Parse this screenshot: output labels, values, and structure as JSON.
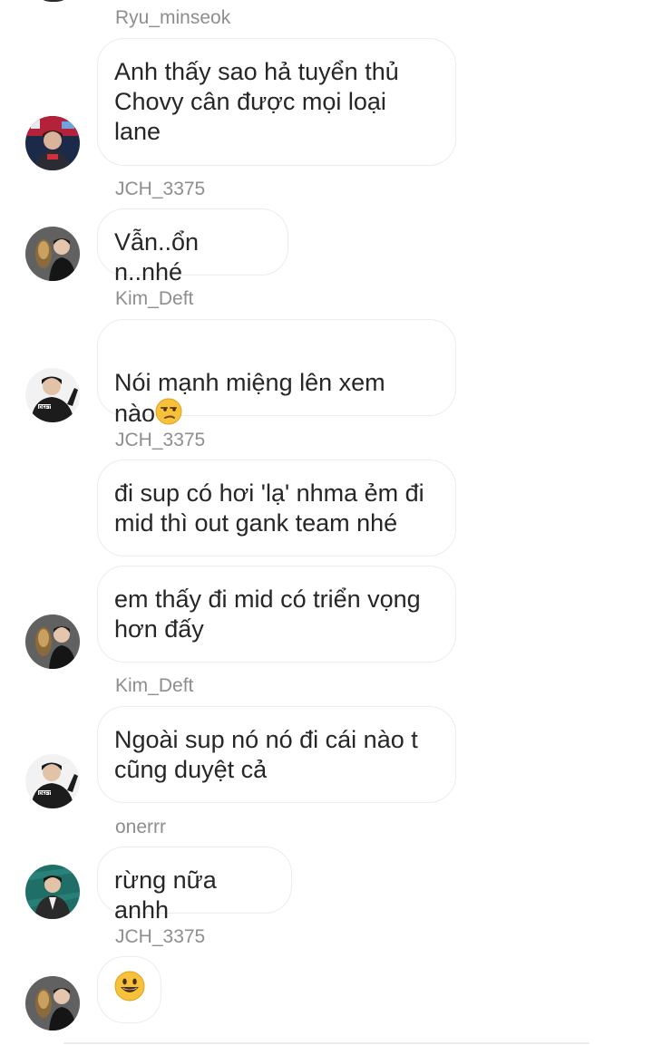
{
  "messages": [
    {
      "sender": "Ryu_minseok",
      "lines": [
        "Anh thấy sao hả tuyển thủ",
        "Chovy cân được mọi loại",
        "lane"
      ]
    },
    {
      "sender": "JCH_3375",
      "lines": [
        "Vẫn..ổn n..nhé"
      ]
    },
    {
      "sender": "Kim_Deft",
      "lines": [
        "Nói mạnh miệng lên xem",
        "nào"
      ],
      "emoji": "unamused-face"
    },
    {
      "sender": "JCH_3375",
      "lines": [
        "đi sup có hơi 'lạ' nhma ẻm đi",
        "mid thì out gank team nhé"
      ]
    },
    {
      "sender": "",
      "lines": [
        "em thấy đi mid có triển vọng",
        "hơn đấy"
      ]
    },
    {
      "sender": "Kim_Deft",
      "lines": [
        "Ngoài sup nó nó đi cái nào t",
        "cũng duyệt cả"
      ]
    },
    {
      "sender": "onerrr",
      "lines": [
        "rừng nữa anhh"
      ]
    },
    {
      "sender": "JCH_3375",
      "lines": [],
      "emoji": "grinning-face"
    }
  ],
  "names": {
    "n1": "Ryu_minseok",
    "n2": "JCH_3375",
    "n3": "Kim_Deft",
    "n4": "JCH_3375",
    "n5": "Kim_Deft",
    "n6": "onerrr",
    "n7": "JCH_3375"
  },
  "bubbles": {
    "b1": "Anh thấy sao hả tuyển thủ\nChovy cân được mọi loại\nlane",
    "b2": "Vẫn..ổn n..nhé",
    "b3_text": "Nói mạnh miệng lên xem\nnào",
    "b4": "đi sup có hơi 'lạ' nhma ẻm đi\nmid thì out gank team nhé",
    "b5": "em thấy đi mid có triển vọng\nhơn đấy",
    "b6": "Ngoài sup nó nó đi cái nào t\ncũng duyệt cả",
    "b7": "rừng nữa anhh"
  },
  "icons": {
    "avatars": [
      "ryu-minseok-avatar",
      "jch-avatar",
      "kim-deft-avatar",
      "onerrr-avatar"
    ],
    "emojis": [
      "unamused-face-icon",
      "grinning-face-icon"
    ]
  },
  "colors": {
    "sender_name": "#8e8e8e",
    "bubble_border": "#ececec",
    "text": "#262626"
  }
}
